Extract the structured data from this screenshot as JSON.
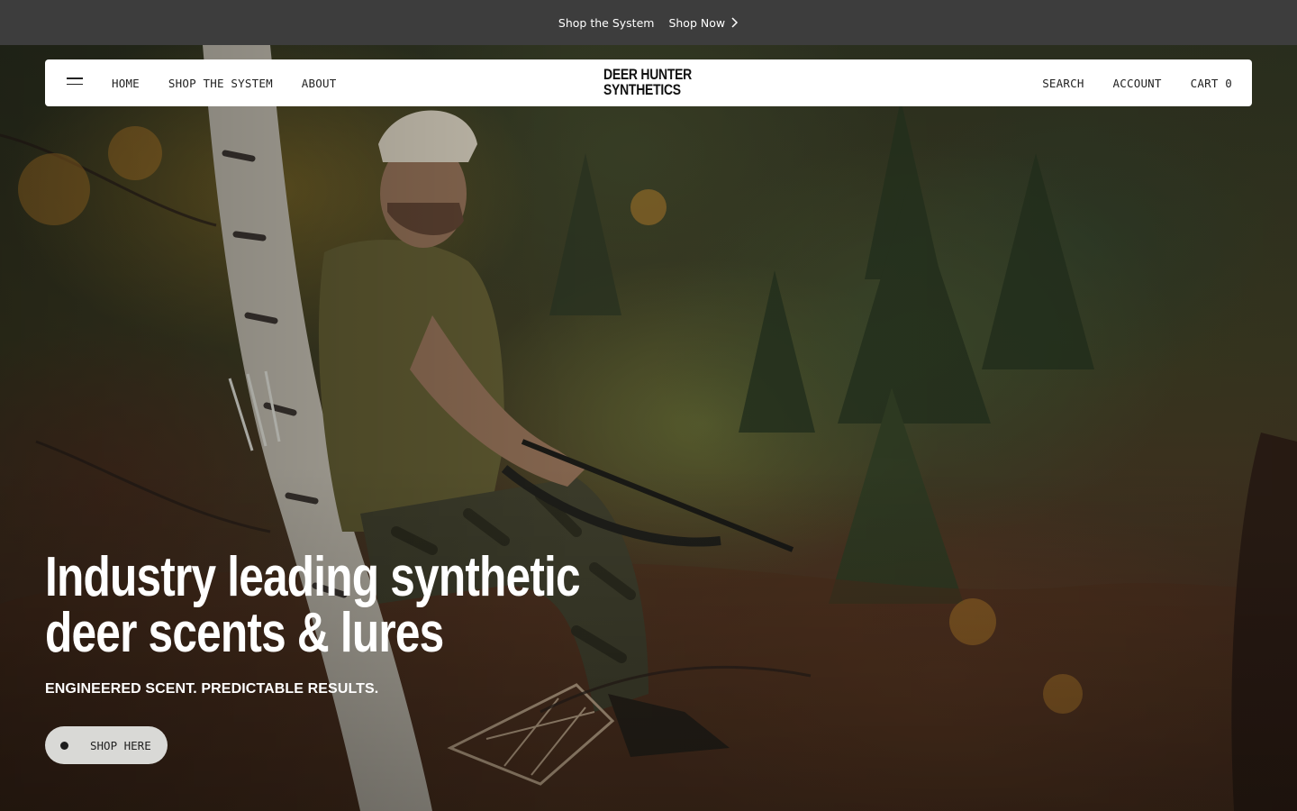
{
  "announcement": {
    "text": "Shop the System",
    "link_label": "Shop Now",
    "link_icon": "chevron-right-icon"
  },
  "header": {
    "menu_icon": "hamburger-menu-icon",
    "nav_left": [
      "HOME",
      "SHOP THE SYSTEM",
      "ABOUT"
    ],
    "logo_line1": "DEER HUNTER",
    "logo_line2": "SYNTHETICS",
    "nav_right": {
      "search": "SEARCH",
      "account": "ACCOUNT",
      "cart": "CART 0"
    }
  },
  "hero": {
    "headline_line1": "Industry leading synthetic",
    "headline_line2": "deer scents & lures",
    "subheadline": "ENGINEERED SCENT. PREDICTABLE RESULTS.",
    "cta_label": "SHOP HERE",
    "image_alt": "hunter-in-tree-stand-photo"
  },
  "colors": {
    "announcement_bg": "#3d3d3d",
    "header_bg": "#ffffff",
    "cta_bg": "#d9d9d6",
    "text_light": "#ffffff",
    "text_dark": "#222222"
  }
}
